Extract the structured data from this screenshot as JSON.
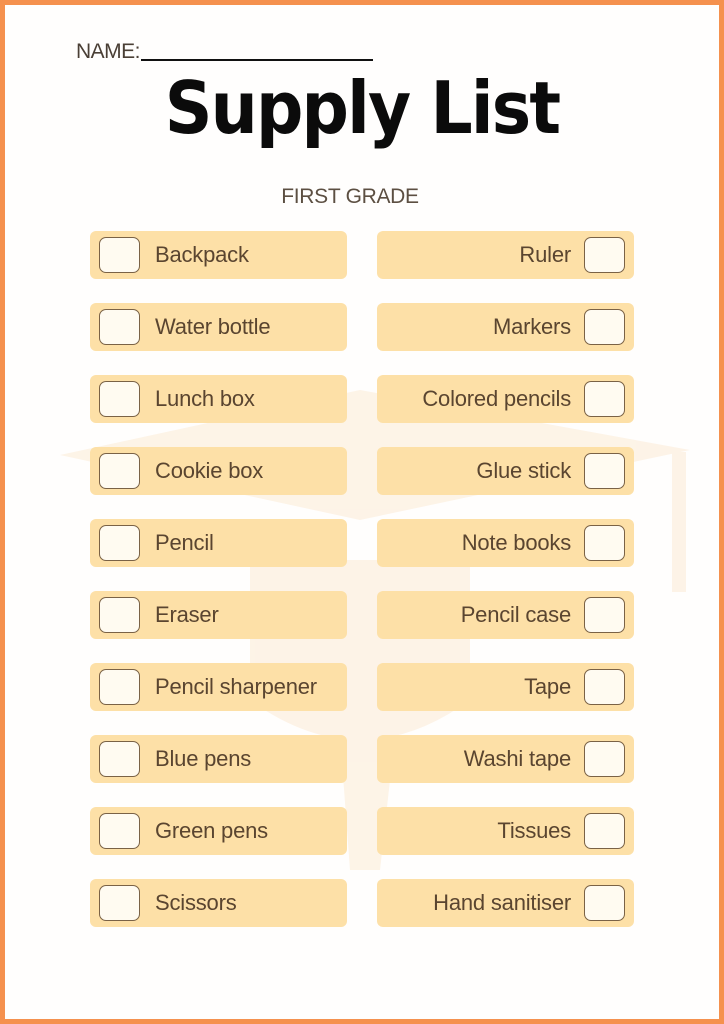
{
  "document": {
    "name_label": "NAME:",
    "title": "Supply List",
    "subtitle": "FIRST GRADE"
  },
  "colors": {
    "border": "#f5914e",
    "row_fill": "#fde0a7",
    "checkbox_fill": "#fffbf1",
    "checkbox_stroke": "#7a6246",
    "text": "#5a4530",
    "title": "#0b0b0b"
  },
  "watermark_icon": "graduation-cap-icon",
  "left_column": [
    {
      "label": "Backpack",
      "checked": false
    },
    {
      "label": "Water bottle",
      "checked": false
    },
    {
      "label": "Lunch box",
      "checked": false
    },
    {
      "label": "Cookie box",
      "checked": false
    },
    {
      "label": "Pencil",
      "checked": false
    },
    {
      "label": "Eraser",
      "checked": false
    },
    {
      "label": "Pencil sharpener",
      "checked": false
    },
    {
      "label": "Blue pens",
      "checked": false
    },
    {
      "label": "Green pens",
      "checked": false
    },
    {
      "label": "Scissors",
      "checked": false
    }
  ],
  "right_column": [
    {
      "label": "Ruler",
      "checked": false
    },
    {
      "label": "Markers",
      "checked": false
    },
    {
      "label": "Colored pencils",
      "checked": false
    },
    {
      "label": "Glue stick",
      "checked": false
    },
    {
      "label": "Note books",
      "checked": false
    },
    {
      "label": "Pencil case",
      "checked": false
    },
    {
      "label": "Tape",
      "checked": false
    },
    {
      "label": "Washi tape",
      "checked": false
    },
    {
      "label": "Tissues",
      "checked": false
    },
    {
      "label": "Hand sanitiser",
      "checked": false
    }
  ]
}
